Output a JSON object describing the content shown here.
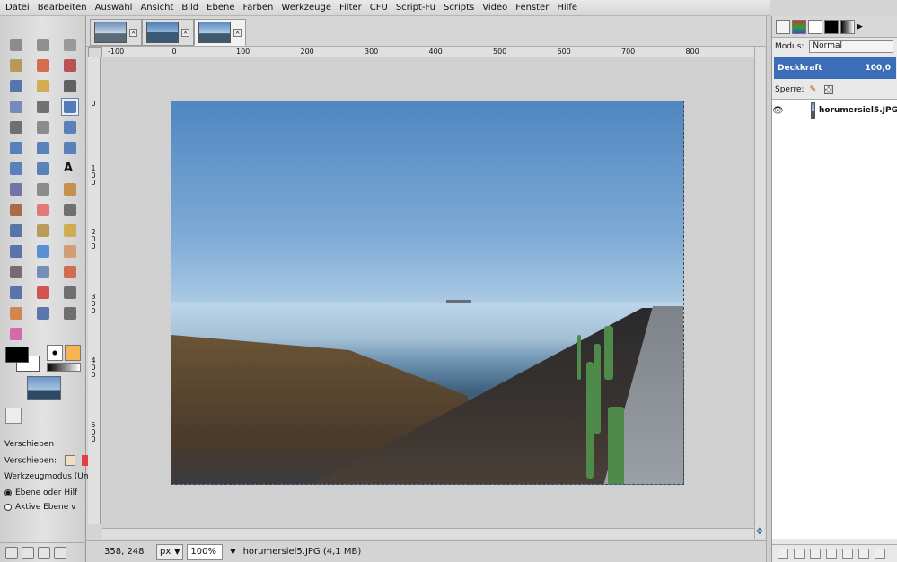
{
  "menubar": {
    "items": [
      "Datei",
      "Bearbeiten",
      "Auswahl",
      "Ansicht",
      "Bild",
      "Ebene",
      "Farben",
      "Werkzeuge",
      "Filter",
      "CFU",
      "Script-Fu",
      "Scripts",
      "Video",
      "Fenster",
      "Hilfe"
    ]
  },
  "toolbox": {
    "tools": [
      {
        "name": "rect-select-icon",
        "color": "#7a7a7a"
      },
      {
        "name": "ellipse-select-icon",
        "color": "#7a7a7a"
      },
      {
        "name": "free-select-icon",
        "color": "#8a8a8a"
      },
      {
        "name": "fuzzy-select-icon",
        "color": "#b08a3a"
      },
      {
        "name": "select-by-color-icon",
        "color": "#d0502a"
      },
      {
        "name": "scissors-select-icon",
        "color": "#b03030"
      },
      {
        "name": "foreground-select-icon",
        "color": "#3a5aa0"
      },
      {
        "name": "paths-icon",
        "color": "#d0a030"
      },
      {
        "name": "color-picker-icon",
        "color": "#444444"
      },
      {
        "name": "zoom-icon",
        "color": "#5a7ab0"
      },
      {
        "name": "measure-icon",
        "color": "#555555"
      },
      {
        "name": "move-icon",
        "color": "#2a5fa8"
      },
      {
        "name": "align-icon",
        "color": "#555555"
      },
      {
        "name": "crop-icon",
        "color": "#777777"
      },
      {
        "name": "rotate-icon",
        "color": "#3a6ab0"
      },
      {
        "name": "scale-icon",
        "color": "#3a6ab0"
      },
      {
        "name": "shear-icon",
        "color": "#3a6ab0"
      },
      {
        "name": "perspective-icon",
        "color": "#3a6ab0"
      },
      {
        "name": "flip-icon",
        "color": "#3a6ab0"
      },
      {
        "name": "cage-transform-icon",
        "color": "#3a6ab0"
      },
      {
        "name": "text-icon",
        "color": "#111111"
      },
      {
        "name": "bucket-fill-icon",
        "color": "#5a5aa0"
      },
      {
        "name": "blend-icon",
        "color": "#777777"
      },
      {
        "name": "pencil-icon",
        "color": "#c08030"
      },
      {
        "name": "paintbrush-icon",
        "color": "#a05020"
      },
      {
        "name": "eraser-icon",
        "color": "#e06060"
      },
      {
        "name": "airbrush-icon",
        "color": "#555555"
      },
      {
        "name": "ink-icon",
        "color": "#3a5aa0"
      },
      {
        "name": "clone-icon",
        "color": "#b08a3a"
      },
      {
        "name": "heal-icon",
        "color": "#d0a030"
      },
      {
        "name": "perspective-clone-icon",
        "color": "#3a5aa0"
      },
      {
        "name": "blur-icon",
        "color": "#3a7ad0"
      },
      {
        "name": "smudge-icon",
        "color": "#d09060"
      },
      {
        "name": "dodge-burn-icon",
        "color": "#555555"
      },
      {
        "name": "levels-icon",
        "color": "#5a7ab0"
      },
      {
        "name": "curves-icon",
        "color": "#d05030"
      },
      {
        "name": "color-balance-icon",
        "color": "#3a5aa0"
      },
      {
        "name": "hue-saturation-icon",
        "color": "#d03030"
      },
      {
        "name": "desaturate-icon",
        "color": "#555555"
      },
      {
        "name": "color-tool-icon",
        "color": "#d07030"
      },
      {
        "name": "histogram-icon",
        "color": "#3a5aa0"
      },
      {
        "name": "brightness-icon",
        "color": "#555555"
      },
      {
        "name": "palette-icon",
        "color": "#d050a0"
      }
    ],
    "options": {
      "title": "Verschieben",
      "label": "Verschieben:",
      "mode_label": "Werkzeugmodus (Umsc",
      "option1": "Ebene oder Hilf",
      "option2": "Aktive Ebene v"
    }
  },
  "tabs": [
    {
      "name": "tab-image-1",
      "active": false
    },
    {
      "name": "tab-image-2",
      "active": false
    },
    {
      "name": "tab-image-3",
      "active": true
    }
  ],
  "ruler": {
    "h_labels": [
      "-100",
      "0",
      "100",
      "200",
      "300",
      "400",
      "500",
      "600",
      "700",
      "800"
    ],
    "v_labels": [
      "0",
      "1 0 0",
      "2 0 0",
      "3 0 0",
      "4 0 0",
      "5 0 0"
    ]
  },
  "statusbar": {
    "coords": "358, 248",
    "unit": "px",
    "zoom": "100%",
    "file_info": "horumersiel5.JPG (4,1 MB)"
  },
  "dock": {
    "mode_label": "Modus:",
    "mode_value": "Normal",
    "opacity_label": "Deckkraft",
    "opacity_value": "100,0",
    "lock_label": "Sperre:",
    "layer_name": "horumersiel5.JPG"
  }
}
